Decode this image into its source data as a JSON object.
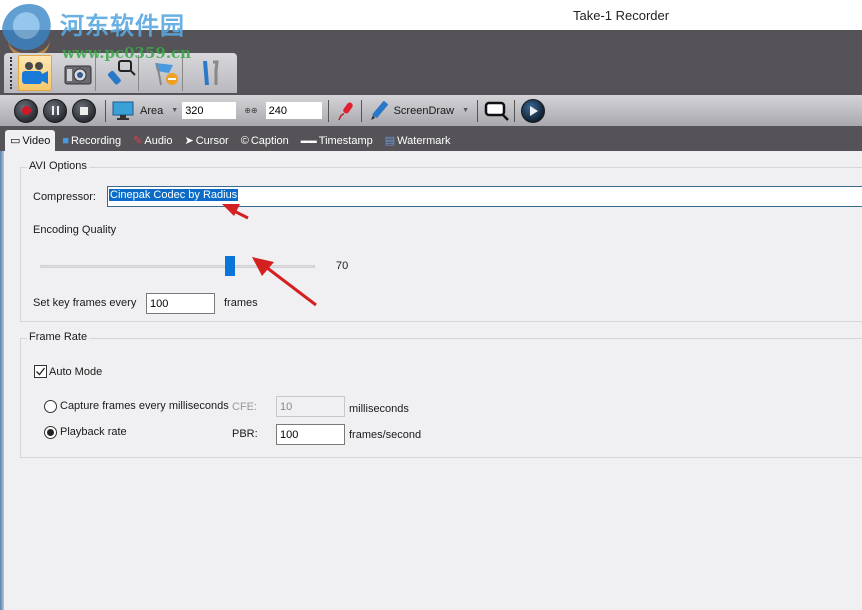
{
  "window": {
    "title": "Take-1 Recorder"
  },
  "watermark": {
    "text": "河东软件园",
    "url": "www.pc0359.cn"
  },
  "mode_bar": {
    "items": [
      {
        "name": "video-camera",
        "active": true
      },
      {
        "name": "photo-camera",
        "active": false
      },
      {
        "name": "zoom-tool",
        "active": false
      },
      {
        "name": "flag-remove",
        "active": false
      },
      {
        "name": "tools",
        "active": false
      }
    ]
  },
  "toolbar": {
    "record_icon": "record-icon",
    "pause_icon": "pause-icon",
    "stop_icon": "stop-icon",
    "area_label": "Area",
    "width_value": "320",
    "link_symbol": "⊕⊕",
    "height_value": "240",
    "screendraw_label": "ScreenDraw"
  },
  "tabs": [
    {
      "label": "Video",
      "icon": "film-icon",
      "active": true
    },
    {
      "label": "Recording",
      "icon": "camcorder-icon",
      "active": false
    },
    {
      "label": "Audio",
      "icon": "microphone-icon",
      "active": false
    },
    {
      "label": "Cursor",
      "icon": "cursor-icon",
      "active": false
    },
    {
      "label": "Caption",
      "icon": "caption-icon",
      "active": false
    },
    {
      "label": "Timestamp",
      "icon": "timestamp-icon",
      "active": false
    },
    {
      "label": "Watermark",
      "icon": "watermark-icon",
      "active": false
    }
  ],
  "avi_options": {
    "title": "AVI Options",
    "compressor_label": "Compressor:",
    "compressor_value": "Cinepak Codec by Radius",
    "encoding_quality_label": "Encoding Quality",
    "encoding_quality_value": 70,
    "encoding_quality_max": 100,
    "encoding_quality_display": "70",
    "keyframes_label": "Set key frames every",
    "keyframes_value": "100",
    "keyframes_unit": "frames"
  },
  "frame_rate": {
    "title": "Frame Rate",
    "auto_mode_label": "Auto Mode",
    "auto_mode_checked": true,
    "capture_label": "Capture frames every milliseconds",
    "capture_selected": false,
    "cfe_label": "CFE:",
    "cfe_value": "10",
    "cfe_unit": "milliseconds",
    "playback_label": "Playback rate",
    "playback_selected": true,
    "pbr_label": "PBR:",
    "pbr_value": "100",
    "pbr_unit": "frames/second"
  },
  "colors": {
    "accent": "#0a74d8",
    "selection": "#0a6cc8",
    "dark_band": "#555357",
    "annotation_arrow": "#d42020"
  }
}
